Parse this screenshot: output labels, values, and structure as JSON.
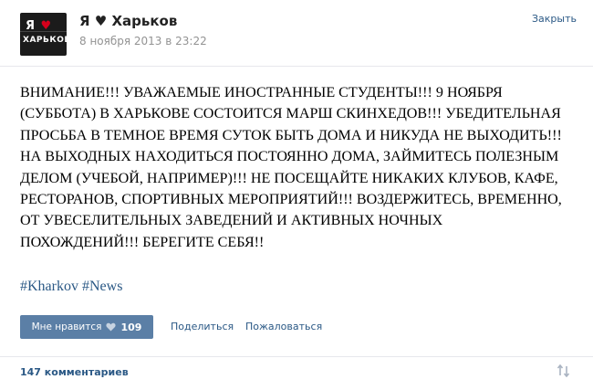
{
  "post": {
    "author": "Я ♥ Харьков",
    "date": "8 ноября 2013 в 23:22",
    "close_label": "Закрыть",
    "avatar": {
      "line1_a": "Я",
      "line1_heart": "♥",
      "line2": "ХАРЬКОВ"
    },
    "text_lines": [
      "ВНИМАНИЕ!!! УВАЖАЕМЫЕ ИНОСТРАННЫЕ СТУДЕНТЫ!!! 9 НОЯБРЯ",
      "(СУББОТА) В ХАРЬКОВЕ СОСТОИТСЯ МАРШ СКИНХЕДОВ!!! УБЕДИТЕЛЬНАЯ",
      "ПРОСЬБА В ТЕМНОЕ ВРЕМЯ СУТОК БЫТЬ ДОМА И НИКУДА НЕ ВЫХОДИТЬ!!!",
      "НА ВЫХОДНЫХ НАХОДИТЬСЯ ПОСТОЯННО ДОМА, ЗАЙМИТЕСЬ ПОЛЕЗНЫМ",
      "ДЕЛОМ (УЧЕБОЙ, НАПРИМЕР)!!! НЕ ПОСЕЩАЙТЕ НИКАКИХ КЛУБОВ, КАФЕ,",
      "РЕСТОРАНОВ, СПОРТИВНЫХ МЕРОПРИЯТИЙ!!! ВОЗДЕРЖИТЕСЬ, ВРЕМЕННО,",
      "ОТ УВЕСЕЛИТЕЛЬНЫХ ЗАВЕДЕНИЙ И АКТИВНЫХ НОЧНЫХ",
      "ПОХОЖДЕНИЙ!!! БЕРЕГИТЕ СЕБЯ!!"
    ],
    "tags": [
      "#Kharkov",
      "#News"
    ]
  },
  "actions": {
    "like_label": "Мне нравится",
    "like_count": "109",
    "share_label": "Поделиться",
    "report_label": "Пожаловаться"
  },
  "comments": {
    "count_label": "147 комментариев"
  },
  "colors": {
    "link": "#2a5885",
    "like_button": "#5b7fa6",
    "background": "#ffffff",
    "meta": "#939393"
  },
  "icons": {
    "like": "heart-icon",
    "sort": "sort-arrows-icon"
  }
}
